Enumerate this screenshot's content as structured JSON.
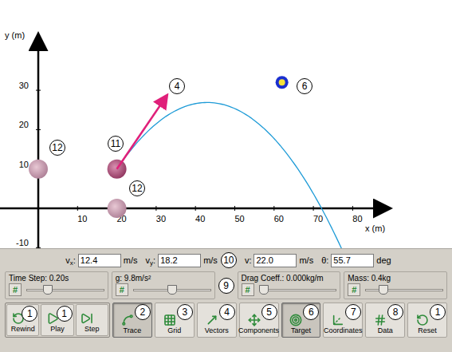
{
  "chart": {
    "y_axis": {
      "title": "y (m)",
      "ticks": [
        "-10",
        "10",
        "20",
        "30"
      ]
    },
    "x_axis": {
      "title": "x (m)",
      "ticks": [
        "10",
        "20",
        "30",
        "40",
        "50",
        "60",
        "70",
        "80"
      ]
    },
    "projectile": {
      "x": 20,
      "y": 10,
      "vx": 12.4,
      "vy": 18.2,
      "g": 9.8
    },
    "ghosts": [
      {
        "x": 0,
        "y": 10
      },
      {
        "x": 20,
        "y": 0
      }
    ],
    "target": {
      "x": 62,
      "y": 32
    },
    "trace": true,
    "vector": true,
    "annotations": [
      {
        "text": "4"
      },
      {
        "text": "6"
      },
      {
        "text": "11"
      },
      {
        "text": "12"
      },
      {
        "text": "12"
      }
    ]
  },
  "velocity": {
    "fields": [
      {
        "label": "v",
        "sub": "x",
        "sep": ":",
        "value": "12.4",
        "unit": "m/s"
      },
      {
        "label": "v",
        "sub": "y",
        "sep": ":",
        "value": "18.2",
        "unit": "m/s"
      },
      {
        "label": "v",
        "sub": "",
        "sep": ":",
        "value": "22.0",
        "unit": "m/s"
      },
      {
        "label": "θ",
        "sub": "",
        "sep": ":",
        "value": "55.7",
        "unit": "deg"
      }
    ],
    "marker": "10"
  },
  "sliders": {
    "items": [
      {
        "title": "Time Step: 0.20s",
        "button": "#",
        "level": 0.25
      },
      {
        "title": "g: 9.8m/s²",
        "button": "#",
        "level": 0.5
      },
      {
        "title": "Drag Coeff.: 0.000kg/m",
        "button": "#",
        "level": 0.0
      },
      {
        "title": "Mass: 0.4kg",
        "button": "#",
        "level": 0.2
      }
    ],
    "marker": "9"
  },
  "playback_buttons": [
    {
      "label": "Rewind",
      "pressed": false,
      "marker": "1"
    },
    {
      "label": "Play",
      "pressed": false,
      "marker": "1"
    },
    {
      "label": "Step",
      "pressed": false,
      "marker": ""
    }
  ],
  "buttons": [
    {
      "label": "Trace",
      "pressed": true,
      "marker": "2"
    },
    {
      "label": "Grid",
      "pressed": false,
      "marker": "3"
    },
    {
      "label": "Vectors",
      "pressed": false,
      "marker": "4"
    },
    {
      "label": "Components",
      "pressed": false,
      "marker": "5"
    },
    {
      "label": "Target",
      "pressed": true,
      "marker": "6"
    },
    {
      "label": "Coordinates",
      "pressed": false,
      "marker": "7"
    },
    {
      "label": "Data",
      "pressed": false,
      "marker": "8"
    },
    {
      "label": "Reset",
      "pressed": false,
      "marker": "1"
    }
  ]
}
